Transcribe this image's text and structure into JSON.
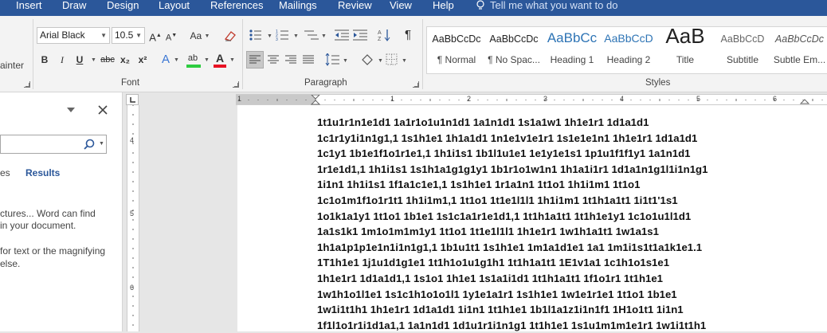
{
  "menu": {
    "items": [
      "Insert",
      "Draw",
      "Design",
      "Layout",
      "References",
      "Mailings",
      "Review",
      "View",
      "Help"
    ],
    "tell_me": "Tell me what you want to do"
  },
  "ribbon": {
    "font": {
      "name": "Arial Black",
      "size": "10.5",
      "group_label": "Font",
      "grow": "A",
      "shrink": "A",
      "case": "Aa",
      "bold": "B",
      "italic": "I",
      "underline": "U",
      "strike": "abc",
      "sub": "x₂",
      "sup": "x²",
      "effects": "A",
      "highlight": "ab",
      "color": "A",
      "highlight_color": "#2ecc40",
      "font_color": "#e81123"
    },
    "paragraph": {
      "group_label": "Paragraph",
      "pilcrow": "¶"
    },
    "styles": {
      "group_label": "Styles",
      "items": [
        {
          "preview": "AaBbCcDc",
          "name": "¶ Normal"
        },
        {
          "preview": "AaBbCcDc",
          "name": "¶ No Spac..."
        },
        {
          "preview": "AaBbCc",
          "name": "Heading 1"
        },
        {
          "preview": "AaBbCcD",
          "name": "Heading 2"
        },
        {
          "preview": "AaB",
          "name": "Title"
        },
        {
          "preview": "AaBbCcD",
          "name": "Subtitle"
        },
        {
          "preview": "AaBbCcDc",
          "name": "Subtle Em..."
        }
      ]
    },
    "clipboard": {
      "painter_label": "ainter"
    }
  },
  "nav_pane": {
    "tab_partial": "es",
    "tab_results": "Results",
    "msg1_line1": "ctures... Word can find",
    "msg1_line2": "in your document.",
    "msg2_line1": "for text or the magnifying",
    "msg2_line2": "else."
  },
  "ruler": {
    "h_numbers": [
      "1",
      "1",
      "2",
      "3",
      "4",
      "5",
      "6"
    ],
    "v_numbers": [
      "4",
      "5",
      "6",
      "7"
    ]
  },
  "document": {
    "lines": [
      "1t1u1r1n1e1d1 1a1r1o1u1n1d1 1a1n1d1 1s1a1w1 1h1e1r1 1d1a1d1",
      "1c1r1y1i1n1g1,1 1s1h1e1 1h1a1d1 1n1e1v1e1r1 1s1e1e1n1 1h1e1r1 1d1a1d1",
      "1c1y1 1b1e1f1o1r1e1,1 1h1i1s1 1b1l1u1e1 1e1y1e1s1 1p1u1f1f1y1 1a1n1d1",
      "1r1e1d1,1 1h1i1s1 1s1h1a1g1g1y1 1b1r1o1w1n1 1h1a1i1r1 1d1a1n1g1l1i1n1g1",
      "1i1n1 1h1i1s1 1f1a1c1e1,1 1s1h1e1 1r1a1n1 1t1o1 1h1i1m1 1t1o1",
      "1c1o1m1f1o1r1t1 1h1i1m1,1 1t1o1 1t1e1l1l1 1h1i1m1 1t1h1a1t1 1i1t1'1s1",
      "1o1k1a1y1 1t1o1 1b1e1 1s1c1a1r1e1d1,1 1t1h1a1t1 1t1h1e1y1 1c1o1u1l1d1",
      "1a1s1k1 1m1o1m1m1y1 1t1o1 1t1e1l1l1 1h1e1r1 1w1h1a1t1 1w1a1s1",
      "1h1a1p1p1e1n1i1n1g1,1 1b1u1t1 1s1h1e1 1m1a1d1e1 1a1 1m1i1s1t1a1k1e1.1",
      "1T1h1e1 1j1u1d1g1e1 1t1h1o1u1g1h1 1t1h1a1t1 1E1v1a1 1c1h1o1s1e1",
      "1h1e1r1 1d1a1d1,1 1s1o1 1h1e1 1s1a1i1d1 1t1h1a1t1 1f1o1r1 1t1h1e1",
      "1w1h1o1l1e1 1s1c1h1o1o1l1 1y1e1a1r1 1s1h1e1 1w1e1r1e1 1t1o1 1b1e1",
      "1w1i1t1h1 1h1e1r1 1d1a1d1 1i1n1 1t1h1e1 1b1l1a1z1i1n1f1 1H1o1t1 1i1n1",
      "1f1l1o1r1i1d1a1,1 1a1n1d1 1d1u1r1i1n1g1 1t1h1e1 1s1u1m1m1e1r1 1w1i1t1h1"
    ]
  }
}
